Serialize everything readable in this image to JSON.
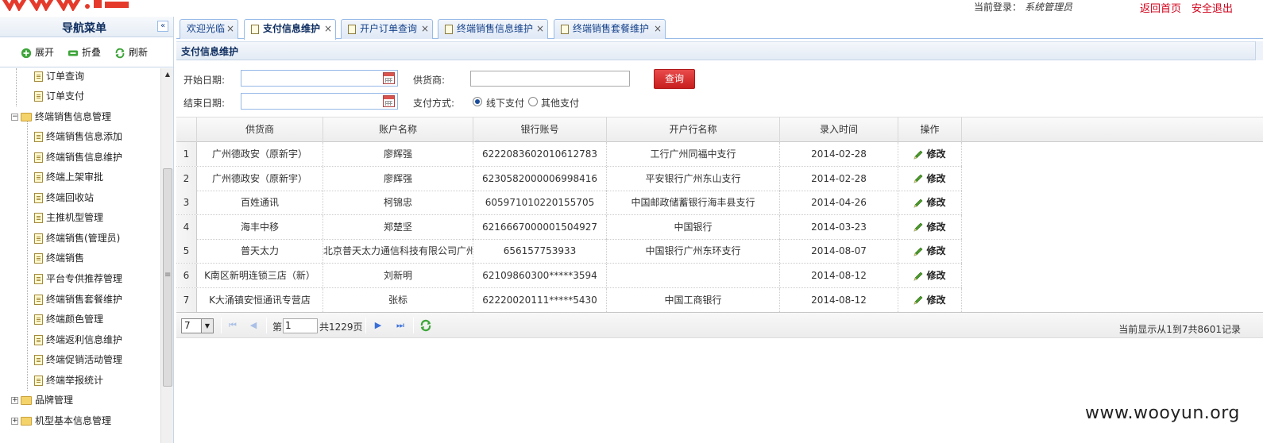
{
  "header": {
    "login_label": "当前登录：",
    "login_user": "系统管理员",
    "home_link": "返回首页",
    "logout_link": "安全退出"
  },
  "nav": {
    "title": "导航菜单",
    "tools": {
      "expand": "展开",
      "collapse": "折叠",
      "refresh": "刷新"
    },
    "tree": [
      {
        "label": "订单查询",
        "kind": "file"
      },
      {
        "label": "订单支付",
        "kind": "file"
      },
      {
        "label": "终端销售信息管理",
        "kind": "folder-open"
      },
      {
        "label": "终端销售信息添加",
        "kind": "file"
      },
      {
        "label": "终端销售信息维护",
        "kind": "file"
      },
      {
        "label": "终端上架审批",
        "kind": "file"
      },
      {
        "label": "终端回收站",
        "kind": "file"
      },
      {
        "label": "主推机型管理",
        "kind": "file"
      },
      {
        "label": "终端销售(管理员)",
        "kind": "file"
      },
      {
        "label": "终端销售",
        "kind": "file"
      },
      {
        "label": "平台专供推荐管理",
        "kind": "file"
      },
      {
        "label": "终端销售套餐维护",
        "kind": "file"
      },
      {
        "label": "终端颜色管理",
        "kind": "file"
      },
      {
        "label": "终端返利信息维护",
        "kind": "file"
      },
      {
        "label": "终端促销活动管理",
        "kind": "file"
      },
      {
        "label": "终端举报统计",
        "kind": "file"
      },
      {
        "label": "品牌管理",
        "kind": "folder"
      },
      {
        "label": "机型基本信息管理",
        "kind": "folder"
      }
    ]
  },
  "tabs": [
    {
      "label": "欢迎光临",
      "active": false
    },
    {
      "label": "支付信息维护",
      "active": true
    },
    {
      "label": "开户订单查询",
      "active": false
    },
    {
      "label": "终端销售信息维护",
      "active": false
    },
    {
      "label": "终端销售套餐维护",
      "active": false
    }
  ],
  "panel": {
    "title": "支付信息维护"
  },
  "form": {
    "start_date_label": "开始日期:",
    "end_date_label": "结束日期:",
    "supplier_label": "供货商:",
    "payment_label": "支付方式:",
    "query_button": "查询",
    "payment_options": [
      {
        "label": "线下支付",
        "checked": true
      },
      {
        "label": "其他支付",
        "checked": false
      }
    ]
  },
  "grid": {
    "columns": [
      "供货商",
      "账户名称",
      "银行账号",
      "开户行名称",
      "录入时间",
      "操作"
    ],
    "rows": [
      {
        "num": "1",
        "supplier": "广州德政安（原新宇）",
        "account": "廖辉强",
        "bank_no": "6222083602010612783",
        "bank": "工行广州同福中支行",
        "date": "2014-02-28",
        "action": "修改"
      },
      {
        "num": "2",
        "supplier": "广州德政安（原新宇）",
        "account": "廖辉强",
        "bank_no": "6230582000006998416",
        "bank": "平安银行广州东山支行",
        "date": "2014-02-28",
        "action": "修改"
      },
      {
        "num": "3",
        "supplier": "百姓通讯",
        "account": "柯锦忠",
        "bank_no": "605971010220155705",
        "bank": "中国邮政储蓄银行海丰县支行",
        "date": "2014-04-26",
        "action": "修改"
      },
      {
        "num": "4",
        "supplier": "海丰中移",
        "account": "郑楚坚",
        "bank_no": "6216667000001504927",
        "bank": "中国银行",
        "date": "2014-03-23",
        "action": "修改"
      },
      {
        "num": "5",
        "supplier": "普天太力",
        "account": "北京普天太力通信科技有限公司广州",
        "bank_no": "656157753933",
        "bank": "中国银行广州东环支行",
        "date": "2014-08-07",
        "action": "修改"
      },
      {
        "num": "6",
        "supplier": "K南区新明连锁三店（新）",
        "account": "刘新明",
        "bank_no": "62109860300*****3594",
        "bank": "",
        "date": "2014-08-12",
        "action": "修改"
      },
      {
        "num": "7",
        "supplier": "K大涌镇安恒通讯专营店",
        "account": "张标",
        "bank_no": "62220020111*****5430",
        "bank": "中国工商银行",
        "date": "2014-08-12",
        "action": "修改"
      }
    ]
  },
  "pager": {
    "page_size": "7",
    "page_prefix": "第",
    "page_value": "1",
    "page_suffix": "共1229页",
    "summary": "当前显示从1到7共8601记录"
  },
  "watermark": "www.wooyun.org",
  "colors": {
    "accent": "#d0021b",
    "nav_title": "#0e2d5f",
    "tab_text": "#15428b",
    "query_button": "#d72626"
  }
}
